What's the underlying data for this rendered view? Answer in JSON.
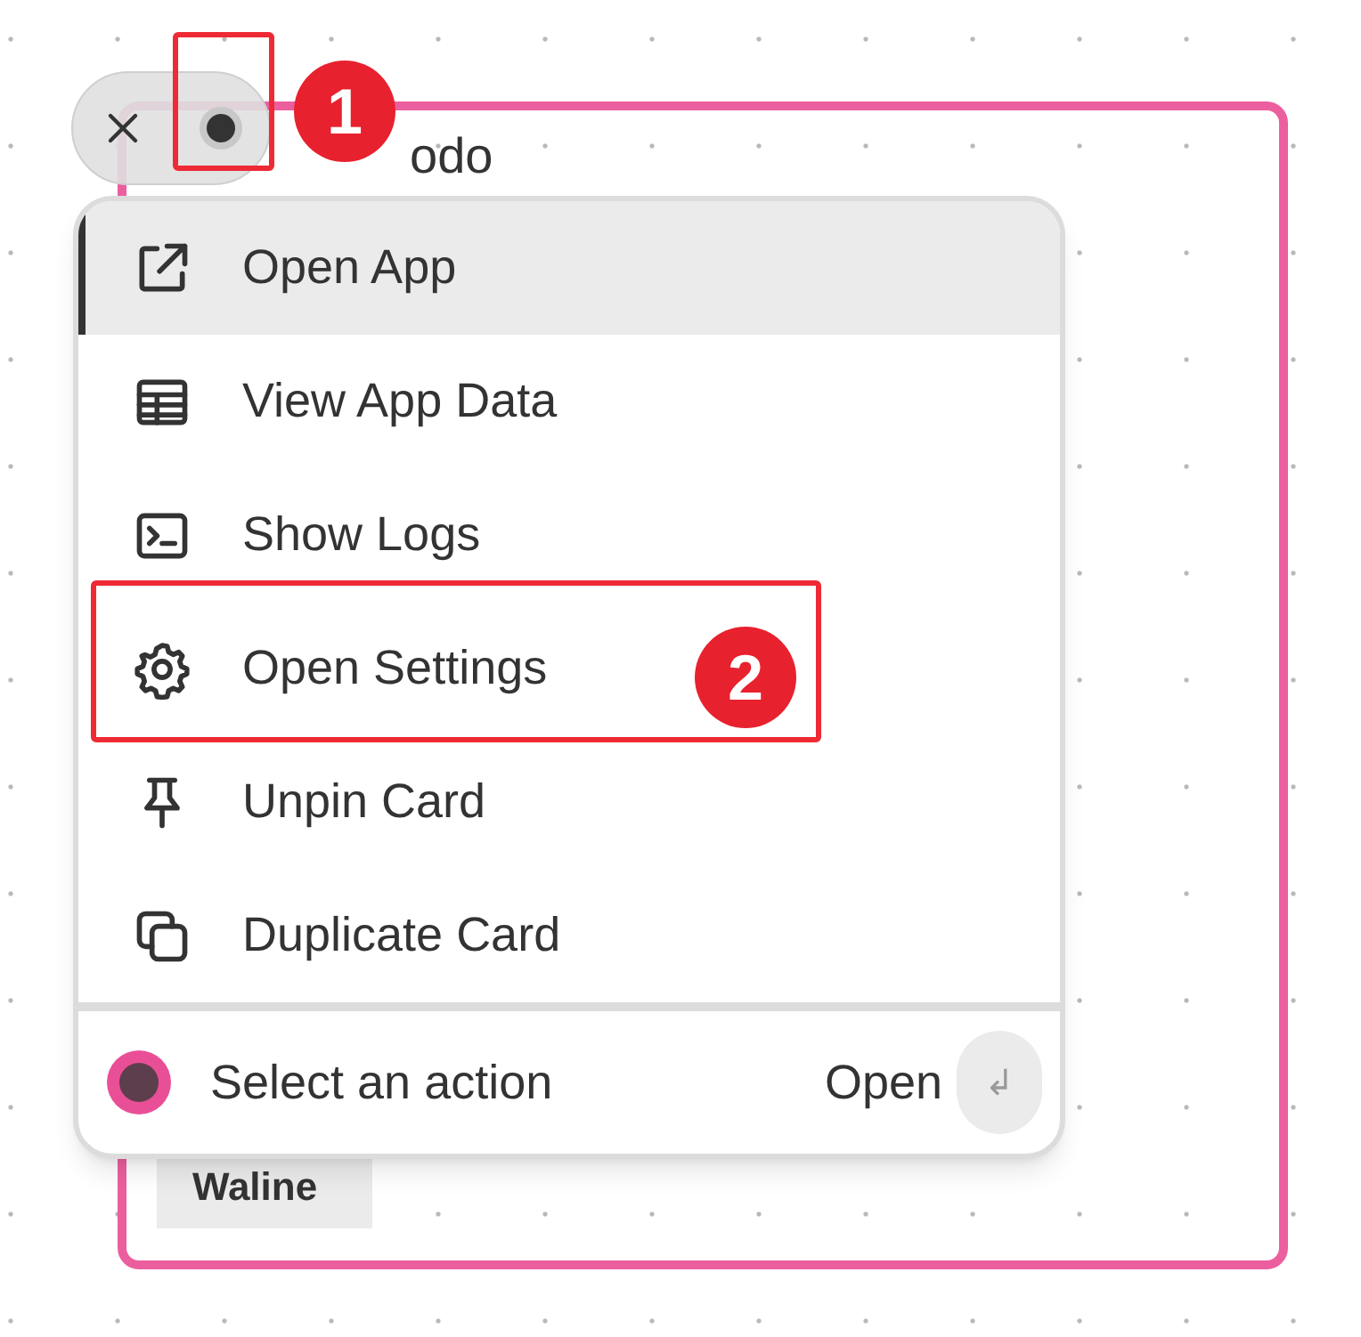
{
  "card": {
    "title": "odo",
    "tag": "Waline"
  },
  "menu": {
    "items": [
      {
        "label": "Open App",
        "kind": "external",
        "selected": true
      },
      {
        "label": "View App Data",
        "kind": "table",
        "selected": false
      },
      {
        "label": "Show Logs",
        "kind": "terminal",
        "selected": false
      },
      {
        "label": "Open Settings",
        "kind": "gear",
        "selected": false
      },
      {
        "label": "Unpin Card",
        "kind": "pin",
        "selected": false
      },
      {
        "label": "Duplicate Card",
        "kind": "copy",
        "selected": false
      }
    ],
    "footer": {
      "placeholder": "Select an action",
      "action": "Open",
      "key": "↲"
    }
  },
  "annotations": [
    {
      "number": "1"
    },
    {
      "number": "2"
    }
  ]
}
